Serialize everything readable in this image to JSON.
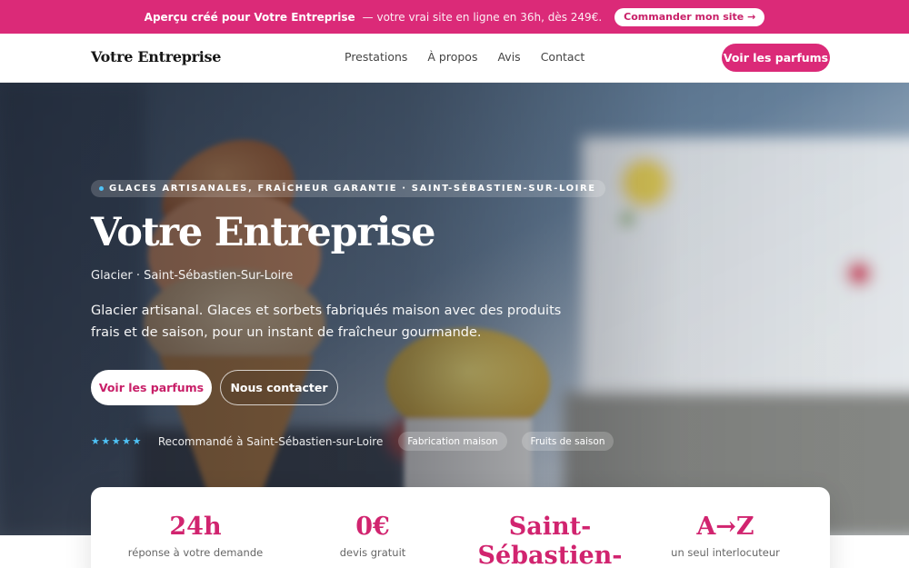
{
  "promo": {
    "strong_text": "Aperçu créé pour Votre Entreprise",
    "text": "— votre vrai site en ligne en 36h, dès 249€.",
    "button": "Commander mon site →"
  },
  "nav": {
    "brand": "Votre Entreprise",
    "links": [
      "Prestations",
      "À propos",
      "Avis",
      "Contact"
    ],
    "cta": "Voir les parfums"
  },
  "hero": {
    "eyebrow": "GLACES ARTISANALES, FRAÎCHEUR GARANTIE · SAINT-SÉBASTIEN-SUR-LOIRE",
    "title": "Votre Entreprise",
    "subtitle": "Glacier · Saint-Sébastien-Sur-Loire",
    "description": "Glacier artisanal. Glaces et sorbets fabriqués maison avec des produits frais et de saison, pour un instant de fraîcheur gourmande.",
    "primary_button": "Voir les parfums",
    "secondary_button": "Nous contacter",
    "stars": "★★★★★",
    "trust_text": "Recommandé à Saint-Sébastien-sur-Loire",
    "tags": [
      "Fabrication maison",
      "Fruits de saison"
    ]
  },
  "stats": [
    {
      "value": "24h",
      "label": "réponse à votre demande"
    },
    {
      "value": "0€",
      "label": "devis gratuit"
    },
    {
      "value": "Saint-Sébastien-",
      "label": ""
    },
    {
      "value": "A→Z",
      "label": "un seul interlocuteur"
    }
  ],
  "colors": {
    "accent": "#db2a78",
    "star": "#4fc3f7"
  }
}
